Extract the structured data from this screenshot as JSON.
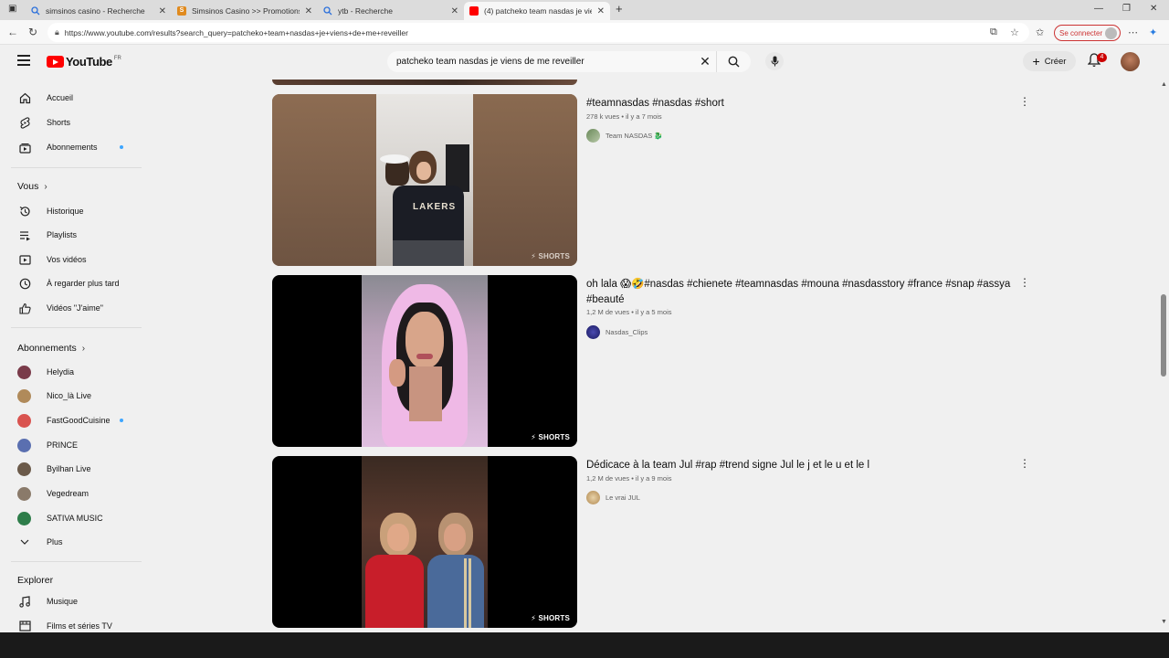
{
  "browser": {
    "tabs": [
      {
        "title": "simsinos casino - Recherche",
        "icon": "search-icon",
        "active": false
      },
      {
        "title": "Simsinos Casino >> Promotions",
        "icon": "s-favicon",
        "active": false
      },
      {
        "title": "ytb - Recherche",
        "icon": "search-icon",
        "active": false
      },
      {
        "title": "(4) patcheko team nasdas je viens",
        "icon": "youtube-favicon",
        "active": true
      }
    ],
    "url": "https://www.youtube.com/results?search_query=patcheko+team+nasdas+je+viens+de+me+reveiller",
    "signin_label": "Se connecter"
  },
  "header": {
    "logo_text": "YouTube",
    "country_code": "FR",
    "search_query": "patcheko team nasdas je viens de me reveiller",
    "create_label": "Créer",
    "notification_count": "4"
  },
  "sidebar": {
    "main": [
      {
        "label": "Accueil",
        "icon": "home-icon"
      },
      {
        "label": "Shorts",
        "icon": "shorts-icon"
      },
      {
        "label": "Abonnements",
        "icon": "subscriptions-icon",
        "dot": true
      }
    ],
    "you_heading": "Vous",
    "you_items": [
      {
        "label": "Historique",
        "icon": "history-icon"
      },
      {
        "label": "Playlists",
        "icon": "playlist-icon"
      },
      {
        "label": "Vos vidéos",
        "icon": "your-videos-icon"
      },
      {
        "label": "À regarder plus tard",
        "icon": "watch-later-icon"
      },
      {
        "label": "Vidéos \"J'aime\"",
        "icon": "thumb-up-icon"
      }
    ],
    "subs_heading": "Abonnements",
    "subscriptions": [
      {
        "label": "Helydia",
        "color": "#7a3b4a"
      },
      {
        "label": "Nico_là Live",
        "color": "#b08a5a"
      },
      {
        "label": "FastGoodCuisine",
        "color": "#d9534f",
        "dot": true
      },
      {
        "label": "PRINCE",
        "color": "#5a6fb0"
      },
      {
        "label": "Byilhan Live",
        "color": "#6b5a4a"
      },
      {
        "label": "Vegedream",
        "color": "#8a7a6a"
      },
      {
        "label": "SATIVA MUSIC",
        "color": "#2e7d4a"
      }
    ],
    "more_label": "Plus",
    "explore_heading": "Explorer",
    "explore_items": [
      {
        "label": "Musique",
        "icon": "music-icon"
      },
      {
        "label": "Films et séries TV",
        "icon": "film-icon"
      }
    ]
  },
  "results": [
    {
      "title": "#teamnasdas #nasdas #short",
      "views": "278 k vues",
      "age": "il y a 7 mois",
      "channel": "Team NASDAS 🐉",
      "shorts_label": "SHORTS"
    },
    {
      "title": "oh lala 😱🤣#nasdas #chienete #teamnasdas #mouna #nasdasstory #france #snap #assya #beauté",
      "views": "1,2 M de vues",
      "age": "il y a 5 mois",
      "channel": "Nasdas_Clips",
      "shorts_label": "SHORTS"
    },
    {
      "title": "Dédicace à la team Jul #rap #trend signe Jul le j et le u et le l",
      "views": "1,2 M de vues",
      "age": "il y a 9 mois",
      "channel": "Le vrai JUL",
      "shorts_label": "SHORTS"
    }
  ]
}
